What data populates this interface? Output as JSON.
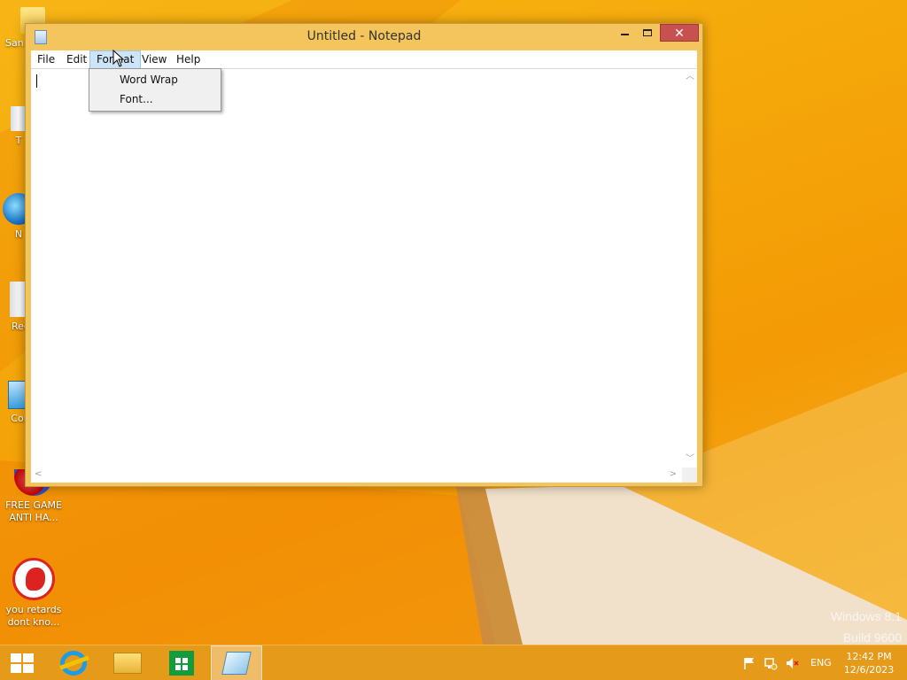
{
  "window": {
    "title": "Untitled - Notepad",
    "close_glyph": "✕"
  },
  "menubar": {
    "items": [
      "File",
      "Edit",
      "Format",
      "View",
      "Help"
    ],
    "active": "Format"
  },
  "format_menu": {
    "items": [
      "Word Wrap",
      "Font..."
    ]
  },
  "desktop": {
    "icons": [
      {
        "label": "San",
        "icon": "folder-icon"
      },
      {
        "label": "T",
        "icon": "tool-icon"
      },
      {
        "label": "N",
        "icon": "globe-icon"
      },
      {
        "label": "Rec",
        "icon": "recycle-bin-icon"
      },
      {
        "label": "Con",
        "icon": "control-panel-icon"
      },
      {
        "label": "FREE GAME ANTI HA...",
        "icon": "game-icon"
      },
      {
        "label": "you retards dont kno...",
        "icon": "shortcut-icon"
      }
    ],
    "watermark_line1": "Windows 8.1",
    "watermark_line2": "Build 9600"
  },
  "taskbar": {
    "pinned": [
      "start-icon",
      "internet-explorer-icon",
      "file-explorer-icon",
      "store-icon",
      "notepad-icon"
    ],
    "active": "notepad-icon",
    "tray": {
      "language": "ENG",
      "time": "12:42 PM",
      "date": "12/6/2023"
    }
  },
  "colors": {
    "accent": "#f4c55d",
    "taskbar": "#e69a1a",
    "close": "#c75050",
    "menu_highlight": "#cce4f7"
  }
}
